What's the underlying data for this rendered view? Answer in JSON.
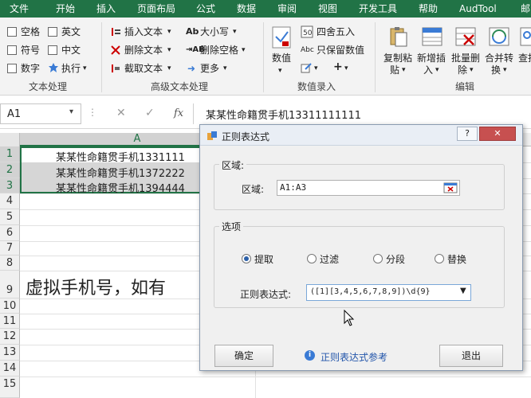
{
  "menu": [
    "文件",
    "开始",
    "插入",
    "页面布局",
    "公式",
    "数据",
    "审阅",
    "视图",
    "开发工具",
    "帮助",
    "AudTool",
    "邮"
  ],
  "ribbon": {
    "text_group": {
      "checkboxes": [
        "空格",
        "英文",
        "符号",
        "中文",
        "数字"
      ],
      "exec_label": "执行",
      "name": "文本处理"
    },
    "adv_group": {
      "buttons": [
        "插入文本",
        "删除文本",
        "截取文本",
        "大小写",
        "删除空格",
        "更多"
      ],
      "name": "高级文本处理"
    },
    "num_group": {
      "big_button": "数值",
      "buttons": [
        "四舍五入",
        "只保留数值"
      ],
      "name": "数值录入"
    },
    "edit_group": {
      "buttons": [
        [
          "复制粘",
          "贴"
        ],
        [
          "新增插",
          "入"
        ],
        [
          "批量删",
          "除"
        ],
        [
          "合并转",
          "换"
        ],
        [
          "查找"
        ]
      ],
      "name": "编辑"
    }
  },
  "formula": {
    "name_box": "A1",
    "fx": "fx",
    "content": "某某性命籍贯手机13311111111"
  },
  "sheet": {
    "col_a": "A",
    "rows": [
      "1",
      "2",
      "3",
      "4",
      "5",
      "6",
      "7",
      "8",
      "9",
      "10",
      "11",
      "12",
      "13",
      "14",
      "15"
    ],
    "cells": [
      "某某性命籍贯手机1331111",
      "某某性命籍贯手机1372222",
      "某某性命籍贯手机1394444"
    ],
    "big_text": "虚拟手机号，如有"
  },
  "dialog": {
    "title": "正则表达式",
    "help": "?",
    "close": "✕",
    "region_legend": "区域:",
    "region_label": "区域:",
    "region_value": "A1:A3",
    "options_legend": "选项",
    "radios": [
      "提取",
      "过滤",
      "分段",
      "替换"
    ],
    "selected": "提取",
    "regex_label": "正则表达式:",
    "regex_value": "([1][3,4,5,6,7,8,9])\\d{9}",
    "ok": "确定",
    "link": "正则表达式参考",
    "cancel": "退出"
  },
  "colors": {
    "accent": "#217346",
    "selection": "#d6d6d6",
    "title_bar": "#e9eef5"
  }
}
